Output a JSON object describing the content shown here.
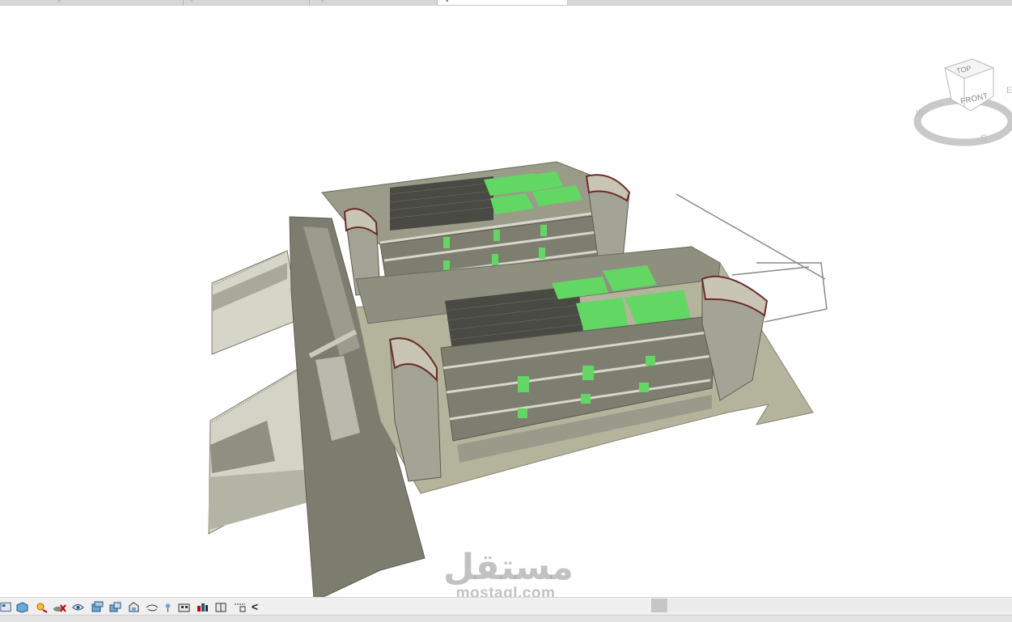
{
  "view_tabs": [
    {
      "name": "view-tab-1",
      "icon": "plan-view-icon"
    },
    {
      "name": "view-tab-2",
      "icon": "plan-view-icon"
    },
    {
      "name": "view-tab-3",
      "icon": "plan-view-icon"
    },
    {
      "name": "view-tab-3d-active",
      "icon": "3d-view-icon"
    },
    {
      "name": "view-tab-5",
      "icon": ""
    }
  ],
  "viewcube": {
    "top_label": "TOP",
    "front_label": "FRONT",
    "compass": {
      "west": "W",
      "south": "S",
      "east": "E"
    }
  },
  "view_control_bar": {
    "tools": [
      "scale-icon",
      "visual-style-icon",
      "sun-path-icon",
      "shadows-icon",
      "render-icon",
      "crop-view-icon",
      "show-crop-icon",
      "unlock-3d-view-icon",
      "temporary-hide-icon",
      "reveal-hidden-icon",
      "analytical-model-icon",
      "highlight-displacement-icon",
      "worksharing-display-icon",
      "reveal-constraints-icon",
      "collapse-arrow-icon"
    ],
    "collapse_label": "<"
  },
  "watermark": {
    "arabic": "مستقل",
    "latin": "mostaql.com"
  },
  "colors": {
    "roof_green": "#62d763",
    "slab": "#9a9a85",
    "facade": "#8c8c7c",
    "base_slab": "#b9b99f"
  }
}
